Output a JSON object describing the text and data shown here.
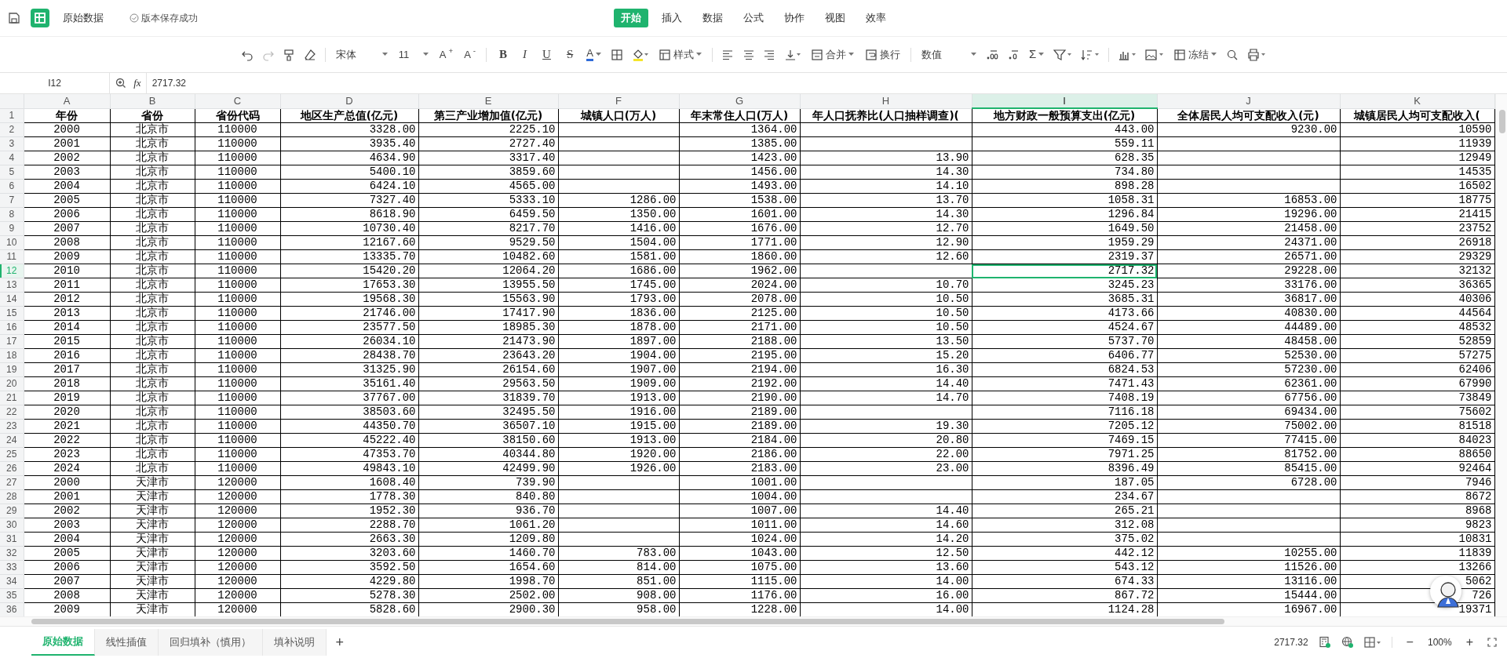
{
  "app_bar": {
    "document_title": "原始数据",
    "save_status": "版本保存成功",
    "menu_tabs": [
      {
        "label": "开始",
        "selected": true
      },
      {
        "label": "插入",
        "selected": false
      },
      {
        "label": "数据",
        "selected": false
      },
      {
        "label": "公式",
        "selected": false
      },
      {
        "label": "协作",
        "selected": false
      },
      {
        "label": "视图",
        "selected": false
      },
      {
        "label": "效率",
        "selected": false
      }
    ]
  },
  "toolbar": {
    "font_name": "宋体",
    "font_size": "11",
    "grow_font": "A$^{+}$",
    "shrink_font": "A$^{-}$",
    "format_buttons": [
      "B",
      "I",
      "U",
      "S"
    ],
    "font_color_label": "A",
    "cell_style": "样式",
    "merge": "合并",
    "wrap": "换行",
    "number_format": "数值",
    "sum": "Σ",
    "freeze": "冻结"
  },
  "formula_bar": {
    "name_box": "I12",
    "fx": "fx",
    "formula": "2717.32"
  },
  "sheet": {
    "columns": [
      {
        "label": "A",
        "selected": false
      },
      {
        "label": "B",
        "selected": false
      },
      {
        "label": "C",
        "selected": false
      },
      {
        "label": "D",
        "selected": false
      },
      {
        "label": "E",
        "selected": false
      },
      {
        "label": "F",
        "selected": false
      },
      {
        "label": "G",
        "selected": false
      },
      {
        "label": "H",
        "selected": false
      },
      {
        "label": "I",
        "selected": true
      },
      {
        "label": "J",
        "selected": false
      },
      {
        "label": "K",
        "selected": false
      }
    ],
    "rows": [
      {
        "number": "1",
        "kind": "header",
        "selected": false,
        "cells": [
          "年份",
          "省份",
          "省份代码",
          "地区生产总值(亿元)",
          "第三产业增加值(亿元)",
          "城镇人口(万人)",
          "年末常住人口(万人)",
          "年人口抚养比(人口抽样调查)(",
          "地方财政一般预算支出(亿元)",
          "全体居民人均可支配收入(元)",
          "城镇居民人均可支配收入("
        ]
      },
      {
        "number": "2",
        "kind": "data",
        "selected": false,
        "cells": [
          "2000",
          "北京市",
          "110000",
          "3328.00",
          "2225.10",
          "",
          "1364.00",
          "",
          "443.00",
          "9230.00",
          "10590"
        ]
      },
      {
        "number": "3",
        "kind": "data",
        "selected": false,
        "cells": [
          "2001",
          "北京市",
          "110000",
          "3935.40",
          "2727.40",
          "",
          "1385.00",
          "",
          "559.11",
          "",
          "11939"
        ]
      },
      {
        "number": "4",
        "kind": "data",
        "selected": false,
        "cells": [
          "2002",
          "北京市",
          "110000",
          "4634.90",
          "3317.40",
          "",
          "1423.00",
          "13.90",
          "628.35",
          "",
          "12949"
        ]
      },
      {
        "number": "5",
        "kind": "data",
        "selected": false,
        "cells": [
          "2003",
          "北京市",
          "110000",
          "5400.10",
          "3859.60",
          "",
          "1456.00",
          "14.30",
          "734.80",
          "",
          "14535"
        ]
      },
      {
        "number": "6",
        "kind": "data",
        "selected": false,
        "cells": [
          "2004",
          "北京市",
          "110000",
          "6424.10",
          "4565.00",
          "",
          "1493.00",
          "14.10",
          "898.28",
          "",
          "16502"
        ]
      },
      {
        "number": "7",
        "kind": "data",
        "selected": false,
        "cells": [
          "2005",
          "北京市",
          "110000",
          "7327.40",
          "5333.10",
          "1286.00",
          "1538.00",
          "13.70",
          "1058.31",
          "16853.00",
          "18775"
        ]
      },
      {
        "number": "8",
        "kind": "data",
        "selected": false,
        "cells": [
          "2006",
          "北京市",
          "110000",
          "8618.90",
          "6459.50",
          "1350.00",
          "1601.00",
          "14.30",
          "1296.84",
          "19296.00",
          "21415"
        ]
      },
      {
        "number": "9",
        "kind": "data",
        "selected": false,
        "cells": [
          "2007",
          "北京市",
          "110000",
          "10730.40",
          "8217.70",
          "1416.00",
          "1676.00",
          "12.70",
          "1649.50",
          "21458.00",
          "23752"
        ]
      },
      {
        "number": "10",
        "kind": "data",
        "selected": false,
        "cells": [
          "2008",
          "北京市",
          "110000",
          "12167.60",
          "9529.50",
          "1504.00",
          "1771.00",
          "12.90",
          "1959.29",
          "24371.00",
          "26918"
        ]
      },
      {
        "number": "11",
        "kind": "data",
        "selected": false,
        "cells": [
          "2009",
          "北京市",
          "110000",
          "13335.70",
          "10482.60",
          "1581.00",
          "1860.00",
          "12.60",
          "2319.37",
          "26571.00",
          "29329"
        ]
      },
      {
        "number": "12",
        "kind": "data",
        "selected": true,
        "cells": [
          "2010",
          "北京市",
          "110000",
          "15420.20",
          "12064.20",
          "1686.00",
          "1962.00",
          "",
          "2717.32",
          "29228.00",
          "32132"
        ]
      },
      {
        "number": "13",
        "kind": "data",
        "selected": false,
        "cells": [
          "2011",
          "北京市",
          "110000",
          "17653.30",
          "13955.50",
          "1745.00",
          "2024.00",
          "10.70",
          "3245.23",
          "33176.00",
          "36365"
        ]
      },
      {
        "number": "14",
        "kind": "data",
        "selected": false,
        "cells": [
          "2012",
          "北京市",
          "110000",
          "19568.30",
          "15563.90",
          "1793.00",
          "2078.00",
          "10.50",
          "3685.31",
          "36817.00",
          "40306"
        ]
      },
      {
        "number": "15",
        "kind": "data",
        "selected": false,
        "cells": [
          "2013",
          "北京市",
          "110000",
          "21746.00",
          "17417.90",
          "1836.00",
          "2125.00",
          "10.50",
          "4173.66",
          "40830.00",
          "44564"
        ]
      },
      {
        "number": "16",
        "kind": "data",
        "selected": false,
        "cells": [
          "2014",
          "北京市",
          "110000",
          "23577.50",
          "18985.30",
          "1878.00",
          "2171.00",
          "10.50",
          "4524.67",
          "44489.00",
          "48532"
        ]
      },
      {
        "number": "17",
        "kind": "data",
        "selected": false,
        "cells": [
          "2015",
          "北京市",
          "110000",
          "26034.10",
          "21473.90",
          "1897.00",
          "2188.00",
          "13.50",
          "5737.70",
          "48458.00",
          "52859"
        ]
      },
      {
        "number": "18",
        "kind": "data",
        "selected": false,
        "cells": [
          "2016",
          "北京市",
          "110000",
          "28438.70",
          "23643.20",
          "1904.00",
          "2195.00",
          "15.20",
          "6406.77",
          "52530.00",
          "57275"
        ]
      },
      {
        "number": "19",
        "kind": "data",
        "selected": false,
        "cells": [
          "2017",
          "北京市",
          "110000",
          "31325.90",
          "26154.60",
          "1907.00",
          "2194.00",
          "16.30",
          "6824.53",
          "57230.00",
          "62406"
        ]
      },
      {
        "number": "20",
        "kind": "data",
        "selected": false,
        "cells": [
          "2018",
          "北京市",
          "110000",
          "35161.40",
          "29563.50",
          "1909.00",
          "2192.00",
          "14.40",
          "7471.43",
          "62361.00",
          "67990"
        ]
      },
      {
        "number": "21",
        "kind": "data",
        "selected": false,
        "cells": [
          "2019",
          "北京市",
          "110000",
          "37767.00",
          "31839.70",
          "1913.00",
          "2190.00",
          "14.70",
          "7408.19",
          "67756.00",
          "73849"
        ]
      },
      {
        "number": "22",
        "kind": "data",
        "selected": false,
        "cells": [
          "2020",
          "北京市",
          "110000",
          "38503.60",
          "32495.50",
          "1916.00",
          "2189.00",
          "",
          "7116.18",
          "69434.00",
          "75602"
        ]
      },
      {
        "number": "23",
        "kind": "data",
        "selected": false,
        "cells": [
          "2021",
          "北京市",
          "110000",
          "44350.70",
          "36507.10",
          "1915.00",
          "2189.00",
          "19.30",
          "7205.12",
          "75002.00",
          "81518"
        ]
      },
      {
        "number": "24",
        "kind": "data",
        "selected": false,
        "cells": [
          "2022",
          "北京市",
          "110000",
          "45222.40",
          "38150.60",
          "1913.00",
          "2184.00",
          "20.80",
          "7469.15",
          "77415.00",
          "84023"
        ]
      },
      {
        "number": "25",
        "kind": "data",
        "selected": false,
        "cells": [
          "2023",
          "北京市",
          "110000",
          "47353.70",
          "40344.80",
          "1920.00",
          "2186.00",
          "22.00",
          "7971.25",
          "81752.00",
          "88650"
        ]
      },
      {
        "number": "26",
        "kind": "data",
        "selected": false,
        "cells": [
          "2024",
          "北京市",
          "110000",
          "49843.10",
          "42499.90",
          "1926.00",
          "2183.00",
          "23.00",
          "8396.49",
          "85415.00",
          "92464"
        ]
      },
      {
        "number": "27",
        "kind": "data",
        "selected": false,
        "cells": [
          "2000",
          "天津市",
          "120000",
          "1608.40",
          "739.90",
          "",
          "1001.00",
          "",
          "187.05",
          "6728.00",
          "7946"
        ]
      },
      {
        "number": "28",
        "kind": "data",
        "selected": false,
        "cells": [
          "2001",
          "天津市",
          "120000",
          "1778.30",
          "840.80",
          "",
          "1004.00",
          "",
          "234.67",
          "",
          "8672"
        ]
      },
      {
        "number": "29",
        "kind": "data",
        "selected": false,
        "cells": [
          "2002",
          "天津市",
          "120000",
          "1952.30",
          "936.70",
          "",
          "1007.00",
          "14.40",
          "265.21",
          "",
          "8968"
        ]
      },
      {
        "number": "30",
        "kind": "data",
        "selected": false,
        "cells": [
          "2003",
          "天津市",
          "120000",
          "2288.70",
          "1061.20",
          "",
          "1011.00",
          "14.60",
          "312.08",
          "",
          "9823"
        ]
      },
      {
        "number": "31",
        "kind": "data",
        "selected": false,
        "cells": [
          "2004",
          "天津市",
          "120000",
          "2663.30",
          "1209.80",
          "",
          "1024.00",
          "14.20",
          "375.02",
          "",
          "10831"
        ]
      },
      {
        "number": "32",
        "kind": "data",
        "selected": false,
        "cells": [
          "2005",
          "天津市",
          "120000",
          "3203.60",
          "1460.70",
          "783.00",
          "1043.00",
          "12.50",
          "442.12",
          "10255.00",
          "11839"
        ]
      },
      {
        "number": "33",
        "kind": "data",
        "selected": false,
        "cells": [
          "2006",
          "天津市",
          "120000",
          "3592.50",
          "1654.60",
          "814.00",
          "1075.00",
          "13.60",
          "543.12",
          "11526.00",
          "13266"
        ]
      },
      {
        "number": "34",
        "kind": "data",
        "selected": false,
        "cells": [
          "2007",
          "天津市",
          "120000",
          "4229.80",
          "1998.70",
          "851.00",
          "1115.00",
          "14.00",
          "674.33",
          "13116.00",
          "5062"
        ]
      },
      {
        "number": "35",
        "kind": "data",
        "selected": false,
        "cells": [
          "2008",
          "天津市",
          "120000",
          "5278.30",
          "2502.00",
          "908.00",
          "1176.00",
          "16.00",
          "867.72",
          "15444.00",
          "726"
        ]
      },
      {
        "number": "36",
        "kind": "data",
        "selected": false,
        "cells": [
          "2009",
          "天津市",
          "120000",
          "5828.60",
          "2900.30",
          "958.00",
          "1228.00",
          "14.00",
          "1124.28",
          "16967.00",
          "19371"
        ]
      }
    ]
  },
  "sheet_tabs": [
    {
      "label": "原始数据",
      "selected": true
    },
    {
      "label": "线性插值",
      "selected": false
    },
    {
      "label": "回归填补（慎用）",
      "selected": false
    },
    {
      "label": "填补说明",
      "selected": false
    }
  ],
  "add_sheet": "+",
  "status_bar": {
    "selection_value": "2717.32",
    "zoom_out": "−",
    "zoom": "100%",
    "zoom_in": "+"
  }
}
